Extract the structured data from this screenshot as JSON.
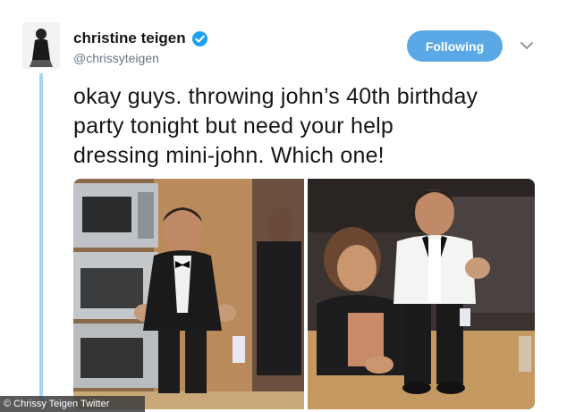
{
  "tweet": {
    "display_name": "christine teigen",
    "handle": "@chrissyteigen",
    "follow_label": "Following",
    "text_lines": [
      "okay guys. throwing john’s 40th birthday",
      "party tonight but need your help",
      "dressing mini-john. Which one!"
    ]
  },
  "photos": [
    {
      "subject": "toddler in black tuxedo in kitchen"
    },
    {
      "subject": "toddler in white tuxedo jacket on table"
    }
  ],
  "credit": "© Chrissy Teigen Twitter",
  "colors": {
    "accent": "#1da1f2",
    "thread_line": "#a7d4f4",
    "text": "#14171a",
    "secondary_text": "#657786"
  },
  "icons": [
    "verified-badge-icon",
    "chevron-down-icon"
  ]
}
